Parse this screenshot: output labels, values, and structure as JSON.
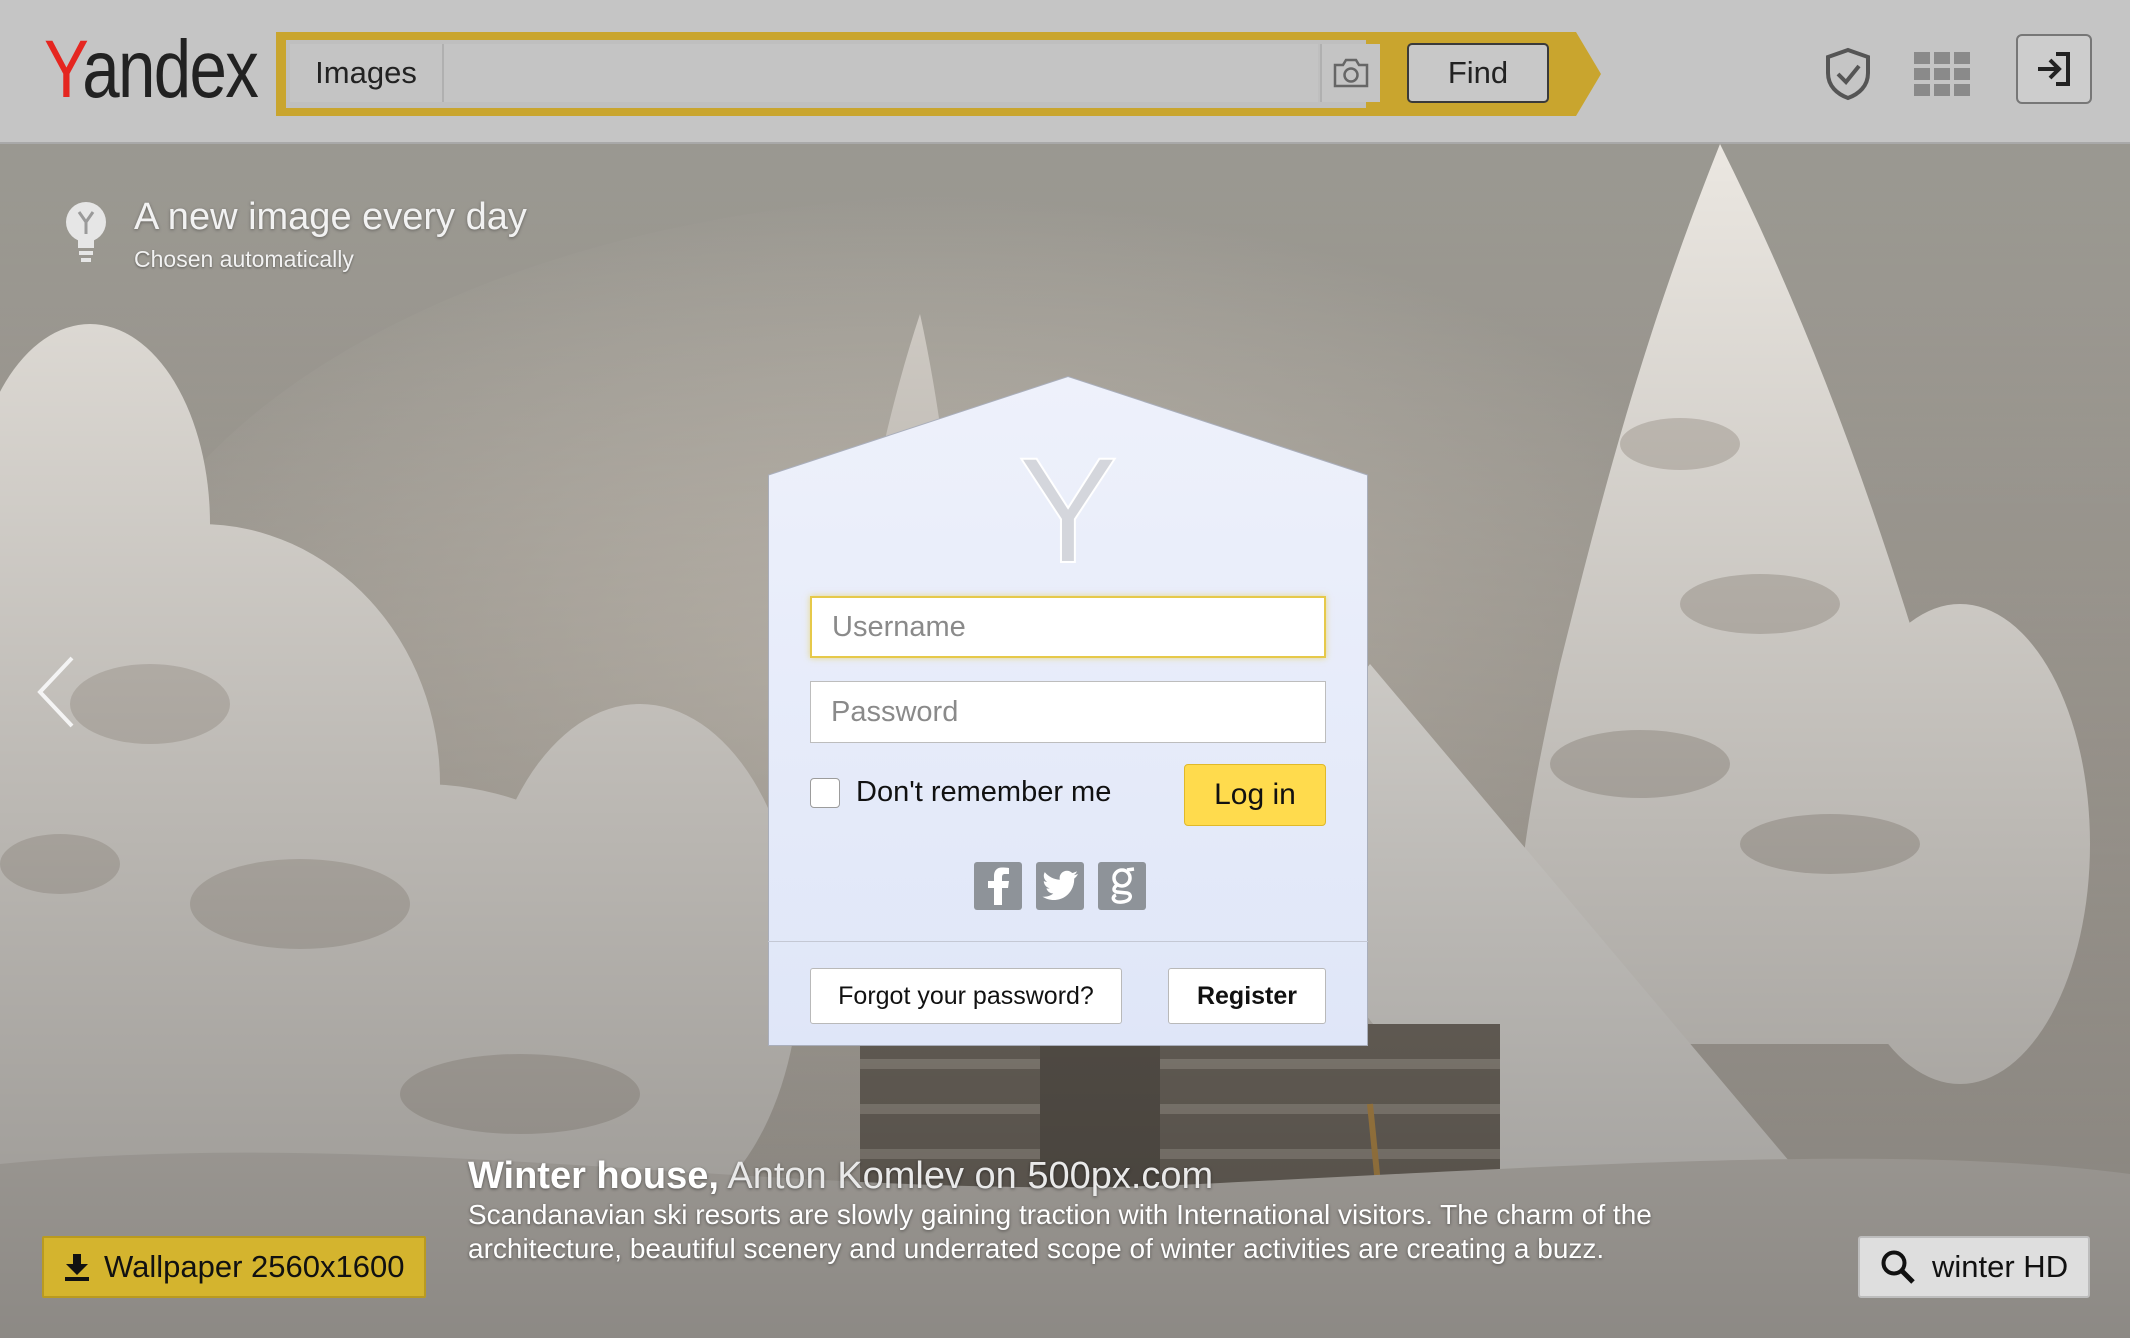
{
  "header": {
    "logo": {
      "first": "Y",
      "rest": "andex"
    },
    "search": {
      "tab_label": "Images",
      "query": "",
      "placeholder": "",
      "find_label": "Find"
    }
  },
  "daily_image": {
    "title": "A new image every day",
    "subtitle": "Chosen automatically"
  },
  "caption": {
    "title": "Winter house,",
    "author": "Anton Komlev on 500px.com",
    "description": "Scandanavian ski resorts are slowly gaining traction with International visitors. The charm of the architecture, beautiful scenery and underrated scope of winter activities are creating a buzz."
  },
  "wallpaper": {
    "label": "Wallpaper 2560x1600"
  },
  "search_tag": {
    "label": "winter HD"
  },
  "login": {
    "logo_letter": "Y",
    "username_placeholder": "Username",
    "password_placeholder": "Password",
    "remember_label": "Don't remember me",
    "login_label": "Log in",
    "forgot_label": "Forgot your password?",
    "register_label": "Register"
  },
  "colors": {
    "brand_red": "#e52620",
    "search_accent": "#c9a52e",
    "login_button": "#ffdb4d",
    "wallpaper_button": "#d4b42e"
  }
}
